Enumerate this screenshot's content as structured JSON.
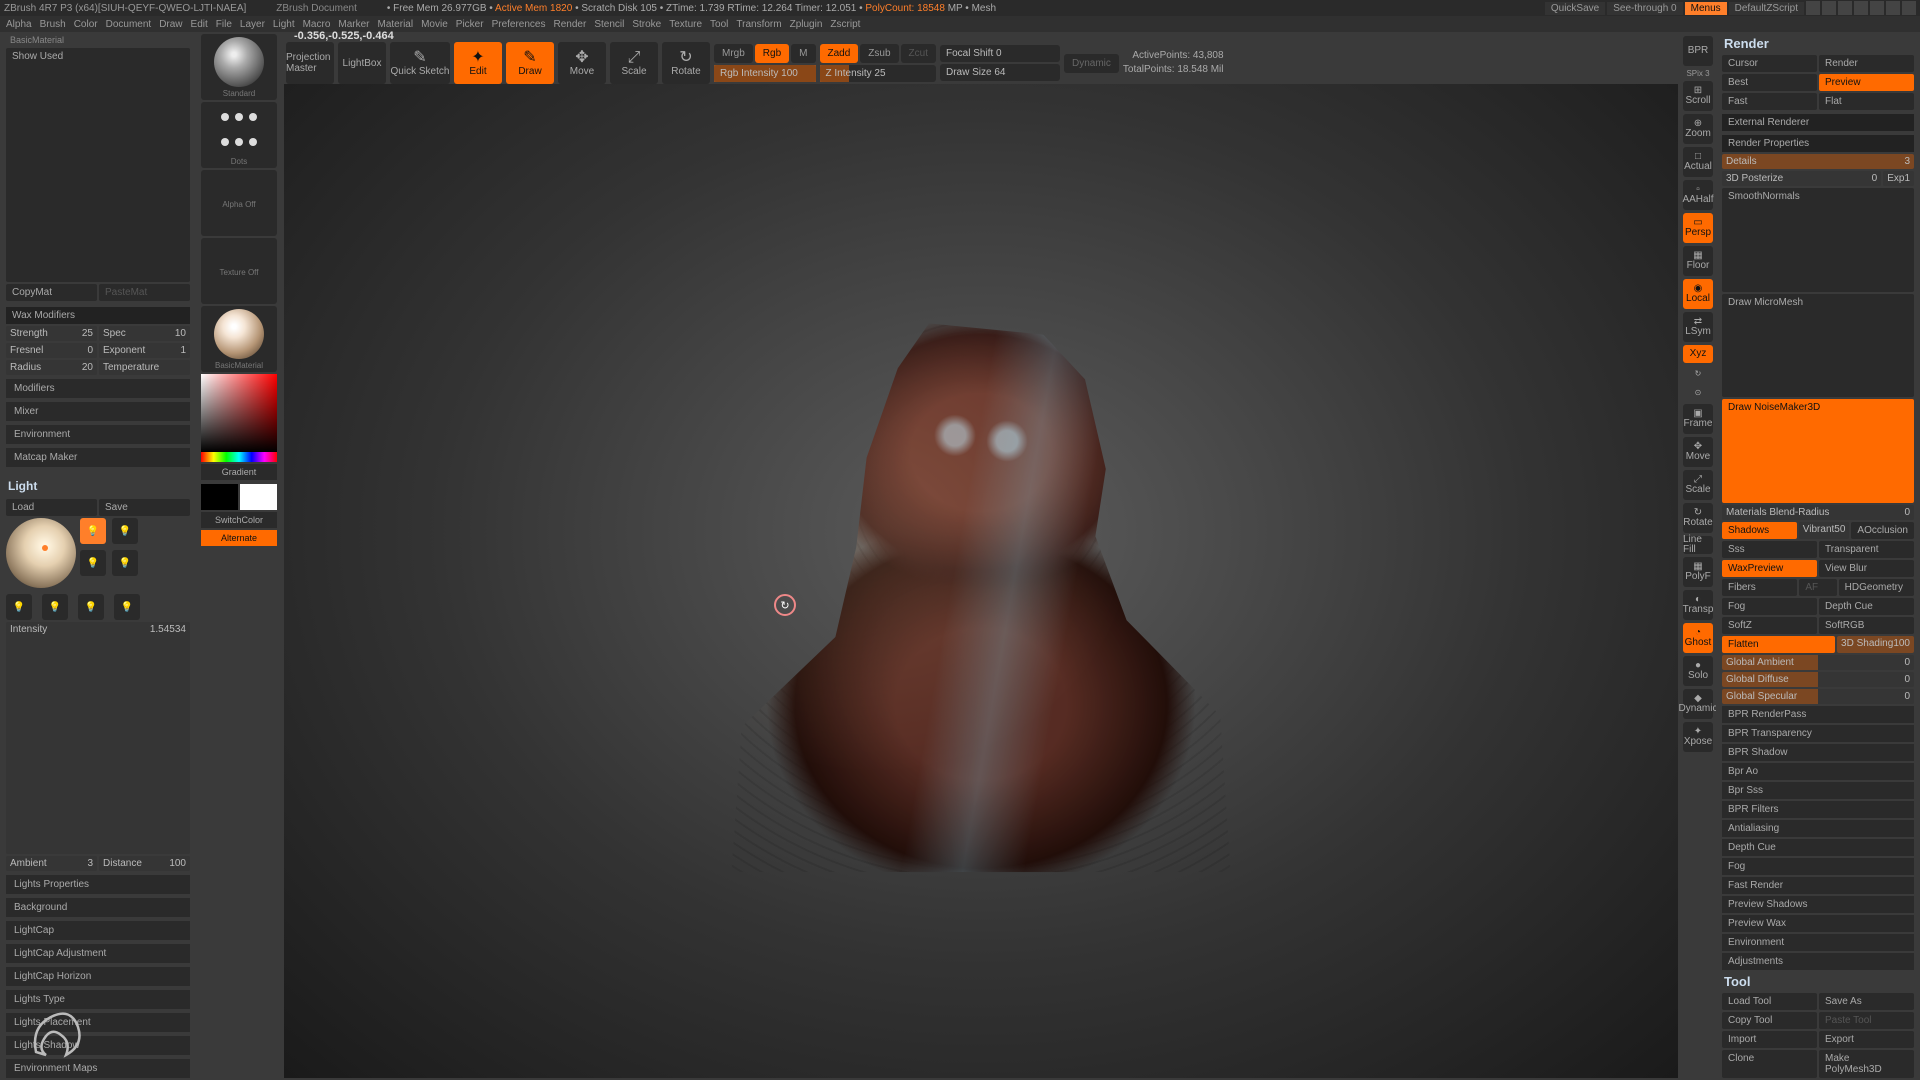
{
  "title": "ZBrush 4R7 P3 (x64)[SIUH-QEYF-QWEO-LJTI-NAEA]",
  "doc_name": "ZBrush Document",
  "header_stats": {
    "free_mem": "Free Mem 26.977GB",
    "active_mem": "Active Mem 1820",
    "scratch": "Scratch Disk 105",
    "ztime": "ZTime: 1.739",
    "rtime": "RTime: 12.264",
    "timer": "Timer: 12.051",
    "polycount": "PolyCount: 18548",
    "mp": "MP",
    "mesh": "Mesh"
  },
  "header_right": {
    "quicksave": "QuickSave",
    "seethrough": "See-through 0",
    "menus": "Menus",
    "default": "DefaultZScript"
  },
  "menus": [
    "Alpha",
    "Brush",
    "Color",
    "Document",
    "Draw",
    "Edit",
    "File",
    "Layer",
    "Light",
    "Macro",
    "Marker",
    "Material",
    "Movie",
    "Picker",
    "Preferences",
    "Render",
    "Stencil",
    "Stroke",
    "Texture",
    "Tool",
    "Transform",
    "Zplugin",
    "Zscript"
  ],
  "readout": "-0.356,-0.525,-0.464",
  "tools": {
    "projection": "Projection Master",
    "lightbox": "LightBox",
    "quicksketch": "Quick Sketch",
    "edit": "Edit",
    "draw": "Draw",
    "move": "Move",
    "scale": "Scale",
    "rotate": "Rotate",
    "mrgb": "Mrgb",
    "rgb": "Rgb",
    "m": "M",
    "rgbi": "Rgb Intensity 100",
    "zadd": "Zadd",
    "zsub": "Zsub",
    "zcut": "Zcut",
    "zi": "Z Intensity 25",
    "focal": "Focal Shift 0",
    "drawsize": "Draw Size 64",
    "dynamic": "Dynamic",
    "active": "ActivePoints: 43,808",
    "total": "TotalPoints: 18.548 Mil"
  },
  "left": {
    "basicmat": "BasicMaterial",
    "showused": "Show Used",
    "copy": "CopyMat",
    "paste": "PasteMat",
    "wax": "Wax Modifiers",
    "strength": {
      "l": "Strength",
      "v": "25"
    },
    "spec": {
      "l": "Spec",
      "v": "10"
    },
    "fresnel": {
      "l": "Fresnel",
      "v": "0"
    },
    "exponent": {
      "l": "Exponent",
      "v": "1"
    },
    "radius": {
      "l": "Radius",
      "v": "20"
    },
    "temp": {
      "l": "Temperature",
      "v": ""
    },
    "modifiers": "Modifiers",
    "mixer": "Mixer",
    "environment": "Environment",
    "matcap": "Matcap Maker",
    "light": "Light",
    "load": "Load",
    "save": "Save",
    "intensity": {
      "l": "Intensity",
      "v": "1.54534"
    },
    "ambient": {
      "l": "Ambient",
      "v": "3"
    },
    "distance": {
      "l": "Distance",
      "v": "100"
    },
    "props": "Lights Properties",
    "bg": "Background",
    "lightcap": "LightCap",
    "lcadj": "LightCap Adjustment",
    "lchor": "LightCap Horizon",
    "ltype": "Lights Type",
    "lplace": "Lights Placement",
    "lshadow": "Lights Shadow",
    "envmaps": "Environment Maps"
  },
  "shelf": {
    "standard": "Standard",
    "dots": "Dots",
    "alphaoff": "Alpha Off",
    "texoff": "Texture Off",
    "basicmat": "BasicMaterial",
    "gradient": "Gradient",
    "switchcolor": "SwitchColor",
    "alternate": "Alternate"
  },
  "rstrip": {
    "bpr": "BPR",
    "spix": "SPix 3",
    "scroll": "Scroll",
    "zoom": "Zoom",
    "actual": "Actual",
    "aahalf": "AAHalf",
    "persp": "Persp",
    "floor": "Floor",
    "local": "Local",
    "lsym": "LSym",
    "xyz": "Xyz",
    "frame": "Frame",
    "move": "Move",
    "scale": "Scale",
    "rotate": "Rotate",
    "polyf": "PolyF",
    "transp": "Transp",
    "ghost": "Ghost",
    "solo": "Solo",
    "xpose": "Xpose",
    "linefill": "Line Fill",
    "dynamic": "Dynamic"
  },
  "render": {
    "title": "Render",
    "cursor": "Cursor",
    "render": "Render",
    "best": "Best",
    "preview": "Preview",
    "fast": "Fast",
    "flat": "Flat",
    "ext": "External Renderer",
    "props": "Render Properties",
    "details": {
      "l": "Details",
      "v": "3"
    },
    "posterize": {
      "l": "3D Posterize",
      "v": "0"
    },
    "exp": {
      "l": "Exp",
      "v": "1"
    },
    "smoothn": "SmoothNormals",
    "micromesh": "Draw MicroMesh",
    "noise3d": "Draw NoiseMaker3D",
    "matblend": {
      "l": "Materials Blend-Radius",
      "v": "0"
    },
    "shadows": "Shadows",
    "vibrant": {
      "l": "Vibrant",
      "v": "50"
    },
    "ao": "AOcclusion",
    "sss": "Sss",
    "transp": "Transparent",
    "waxprev": "WaxPreview",
    "viewblur": "View Blur",
    "fibers": "Fibers",
    "af": "AF",
    "hdgeo": "HDGeometry",
    "fog": "Fog",
    "depthcue": "Depth Cue",
    "softz": "SoftZ",
    "softrgb": "SoftRGB",
    "flatten": "Flatten",
    "shading": {
      "l": "3D Shading",
      "v": "100"
    },
    "gambient": {
      "l": "Global Ambient",
      "v": "0"
    },
    "gdiffuse": {
      "l": "Global Diffuse",
      "v": "0"
    },
    "gspec": {
      "l": "Global Specular",
      "v": "0"
    },
    "items": [
      "BPR RenderPass",
      "BPR Transparency",
      "BPR Shadow",
      "Bpr Ao",
      "Bpr Sss",
      "BPR Filters",
      "Antialiasing",
      "Depth Cue",
      "Fog",
      "Fast Render",
      "Preview Shadows",
      "Preview Wax",
      "Environment",
      "Adjustments"
    ]
  },
  "tool": {
    "title": "Tool",
    "load": "Load Tool",
    "saveas": "Save As",
    "copy": "Copy Tool",
    "paste": "Paste Tool",
    "import": "Import",
    "export": "Export",
    "clone": "Clone",
    "polymesh": "Make PolyMesh3D"
  }
}
